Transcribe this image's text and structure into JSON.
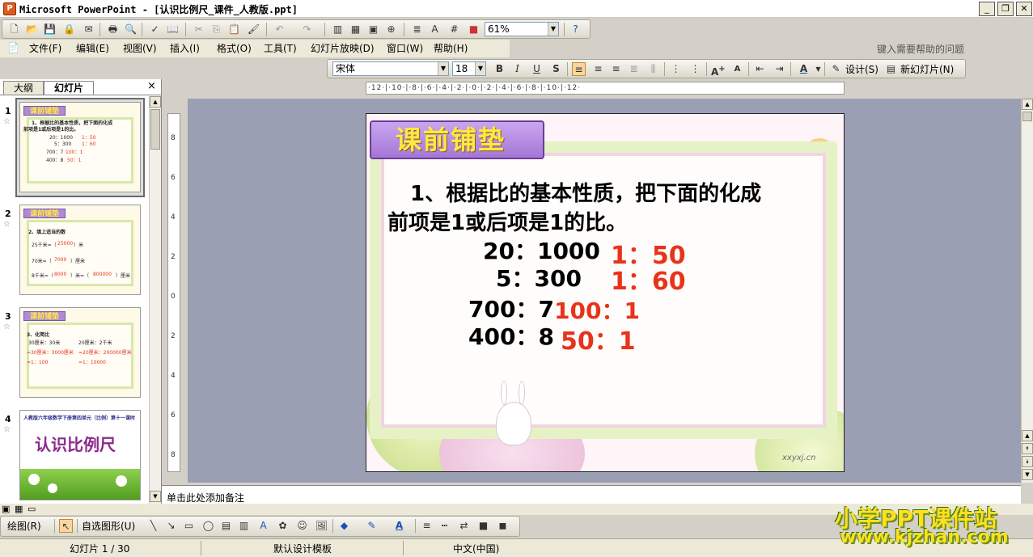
{
  "window": {
    "title": "Microsoft PowerPoint - [认识比例尺_课件_人教版.ppt]",
    "min_label": "_",
    "max_label": "❐",
    "close_label": "✕"
  },
  "standard_toolbar": {
    "zoom_value": "61%"
  },
  "menu": {
    "items": [
      "文件(F)",
      "编辑(E)",
      "视图(V)",
      "插入(I)",
      "格式(O)",
      "工具(T)",
      "幻灯片放映(D)",
      "窗口(W)",
      "帮助(H)"
    ],
    "help_placeholder": "键入需要帮助的问题"
  },
  "format_toolbar": {
    "font": "宋体",
    "size": "18",
    "bold": "B",
    "italic": "I",
    "underline": "U",
    "shadow": "S",
    "design_label": "设计(S)",
    "new_slide_label": "新幻灯片(N)"
  },
  "left_panel": {
    "tab_outline": "大纲",
    "tab_slides": "幻灯片",
    "close": "×",
    "thumbs": [
      {
        "num": "1",
        "header": "课前铺垫",
        "lines": [
          "1、根据比的基本性质，把下面的化成",
          "前项是1或后项是1的比。",
          "20：1000",
          "5：300",
          "700：7",
          "400：8"
        ],
        "answers": [
          "1：50",
          "1：60",
          "100：1",
          "50：1"
        ]
      },
      {
        "num": "2",
        "header": "课前铺垫",
        "lines": [
          "2、填上适当的数",
          "25千米=（",
          "）米",
          "70米=（",
          "）厘米",
          "8千米=（",
          "）米=（",
          "）厘米"
        ],
        "answers": [
          "25000",
          "7000",
          "8000",
          "800000"
        ]
      },
      {
        "num": "3",
        "header": "课前铺垫",
        "lines": [
          "3、化简比",
          "30厘米：30米",
          "20厘米：2千米"
        ],
        "answers": [
          "=30厘米：3000厘米",
          "=20厘米：200000厘米",
          "=1：100",
          "=1：10000"
        ]
      },
      {
        "num": "4",
        "header": "",
        "lines": [
          "人教版六年级数学下册第四单元（比例）第十一课时"
        ],
        "title": "认识比例尺",
        "answers": []
      }
    ]
  },
  "ruler_h": "·12·|·10·|·8·|·6·|·4·|·2·|·0·|·2·|·4·|·6·|·8·|·10·|·12·",
  "ruler_v": "8 6 4 2 0 2 4 6 8",
  "slide": {
    "header": "课前铺垫",
    "line1": "1、根据比的基本性质，把下面的化成",
    "line2": "前项是1或后项是1的比。",
    "q1": "20：1000",
    "q2": "5：300",
    "q3": "700：7",
    "q4": "400：8",
    "a1": "1：50",
    "a2": "1：60",
    "a3": "100：1",
    "a4": "50：1",
    "watermark": "xxyxj.cn"
  },
  "notes": {
    "placeholder": "单击此处添加备注"
  },
  "draw_toolbar": {
    "draw_label": "绘图(R)",
    "autoshape_label": "自选图形(U)"
  },
  "status": {
    "slide_info": "幻灯片 1 / 30",
    "template": "默认设计模板",
    "language": "中文(中国)"
  },
  "watermark": {
    "line1": "小学PPT课件站",
    "line2": "www.kjzhan.com"
  }
}
